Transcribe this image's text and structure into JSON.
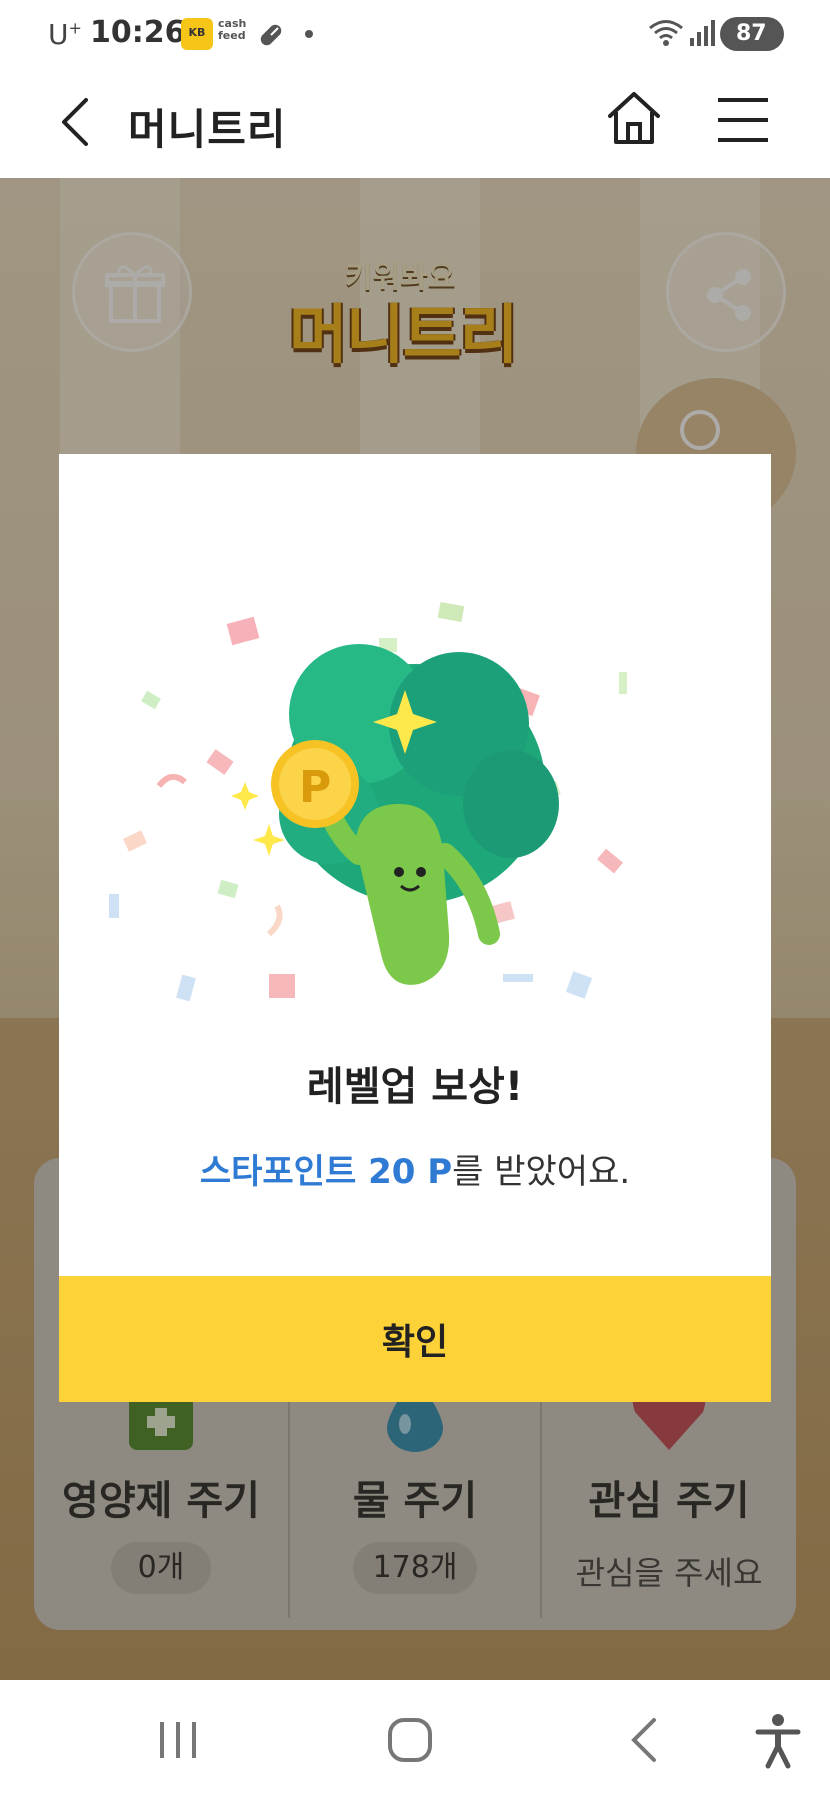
{
  "status_bar": {
    "carrier": "U",
    "carrier_sup": "+",
    "time": "10:26",
    "kb_badge": "KB",
    "cash_line1": "cash",
    "cash_line2": "feed",
    "battery": "87"
  },
  "header": {
    "title": "머니트리",
    "back_icon": "chevron-left-icon",
    "home_icon": "home-icon",
    "menu_icon": "hamburger-menu-icon"
  },
  "game": {
    "logo_top": "키워봐요",
    "logo_main": "머니트리",
    "actions": [
      {
        "label": "영양제 주기",
        "count": "0개",
        "icon": "nutrient-bottle-icon"
      },
      {
        "label": "물 주기",
        "count": "178개",
        "icon": "water-drop-icon"
      },
      {
        "label": "관심 주기",
        "hint": "관심을 주세요",
        "icon": "heart-icon"
      }
    ]
  },
  "modal": {
    "title": "레벨업 보상!",
    "msg_accent": "스타포인트 20 P",
    "msg_rest": "를 받았어요.",
    "confirm": "확인",
    "coin_letter": "P"
  },
  "colors": {
    "accent_yellow": "#fdd239",
    "accent_blue": "#2f7bd4",
    "character_green": "#7cc84a",
    "tree_green": "#1ea87a"
  }
}
